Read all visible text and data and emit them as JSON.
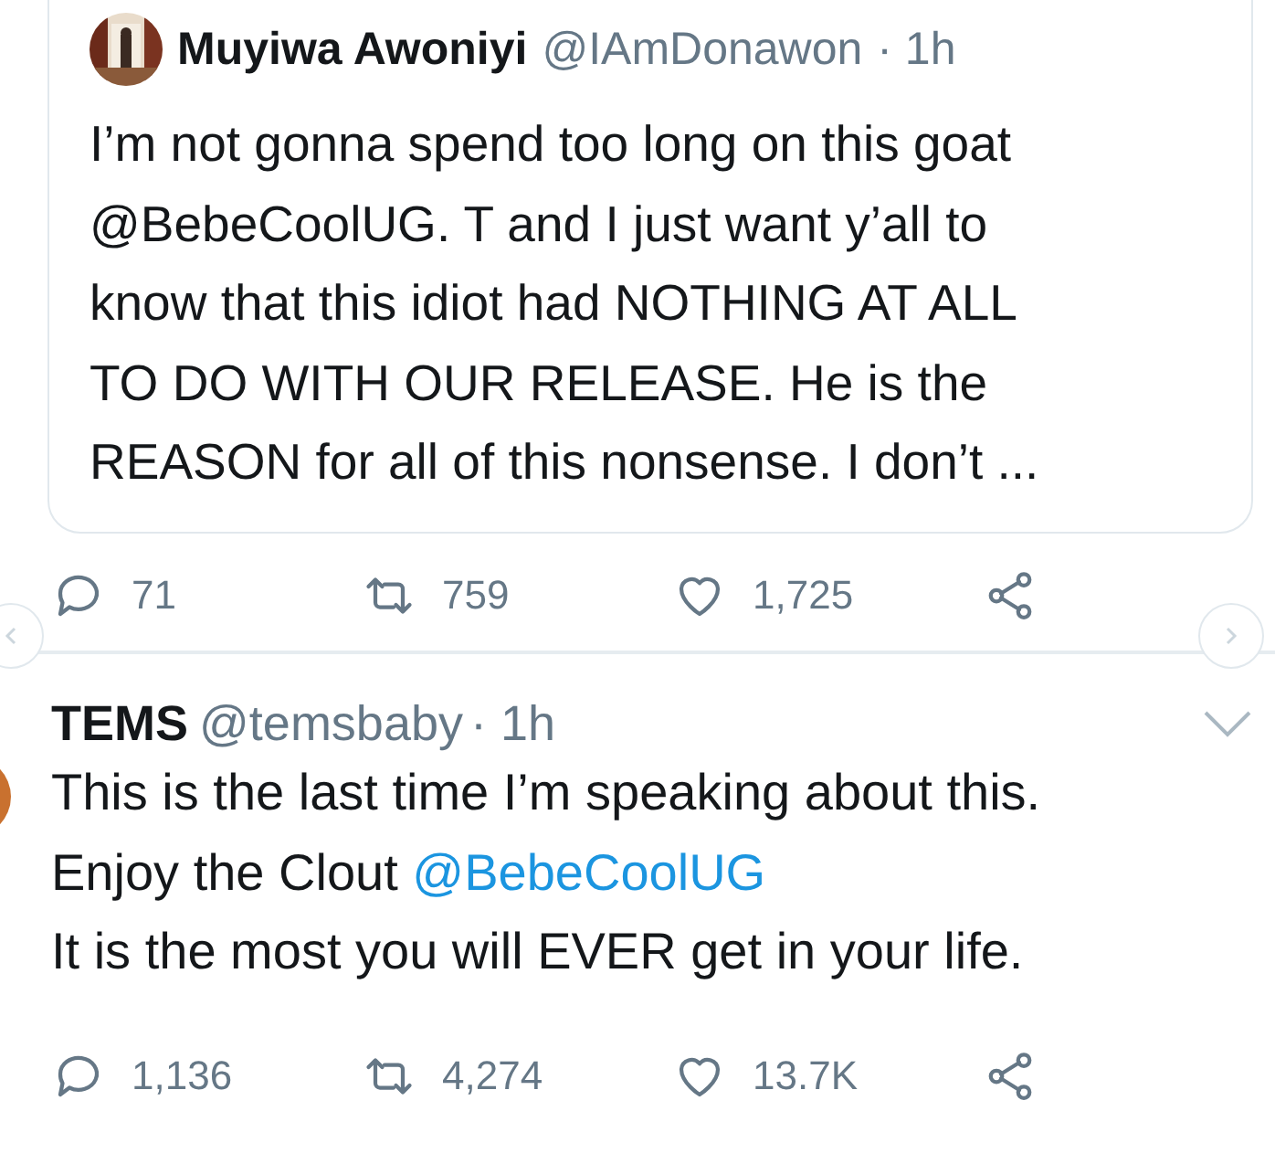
{
  "quoted_tweet": {
    "avatar": {
      "kind": "picture"
    },
    "name": "Muyiwa Awoniyi",
    "handle": "@IAmDonawon",
    "time": "· 1h",
    "lines": [
      [
        {
          "text": "I’m not gonna spend too long on this goat"
        }
      ],
      [
        {
          "text": "@BebeCoolUG. T and I just want y’all to"
        }
      ],
      [
        {
          "text": "know that this idiot had NOTHING AT ALL"
        }
      ],
      [
        {
          "text": "TO DO WITH OUR RELEASE. He is the"
        }
      ],
      [
        {
          "text": "REASON for all of this nonsense. I don’t ..."
        }
      ]
    ]
  },
  "first_actions": {
    "replies": "71",
    "retweets": "759",
    "likes": "1,725"
  },
  "tweet": {
    "avatar": {
      "kind": "picture"
    },
    "name": "TEMS",
    "handle": "@temsbaby",
    "time": "· 1h",
    "lines": [
      [
        {
          "text": "This is the last time I’m speaking about this."
        }
      ],
      [
        {
          "text": "Enjoy the Clout "
        },
        {
          "text": "@BebeCoolUG",
          "kind": "mention"
        }
      ],
      [
        {
          "text": "It is the most you will EVER get in your life."
        }
      ]
    ],
    "actions": {
      "replies": "1,136",
      "retweets": "4,274",
      "likes": "13.7K"
    }
  }
}
